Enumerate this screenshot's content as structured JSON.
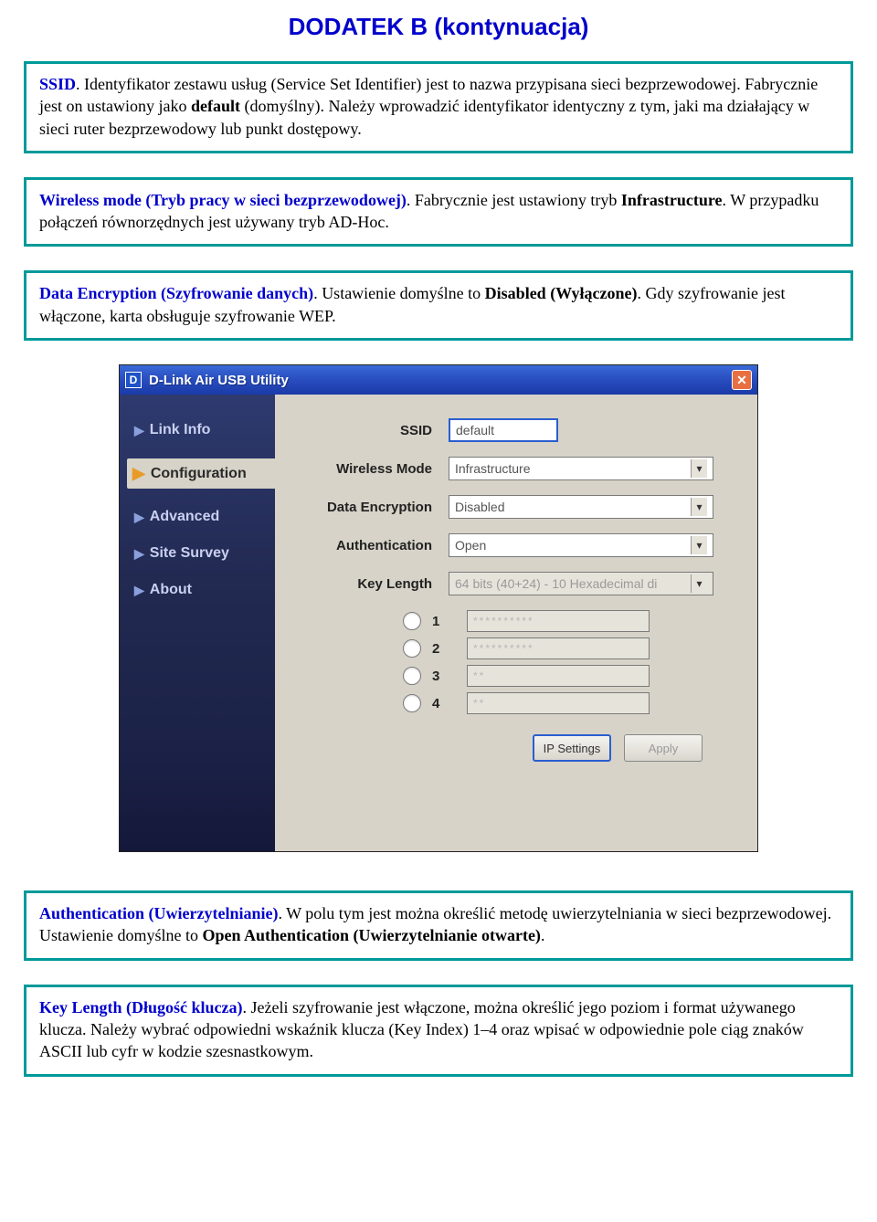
{
  "page": {
    "heading": "DODATEK B (kontynuacja)"
  },
  "callouts": {
    "ssid": {
      "lead": "SSID",
      "text1": ". Identyfikator zestawu usług (Service Set Identifier) jest to nazwa przypisana sieci bezprzewodowej. Fabrycznie jest on ustawiony jako ",
      "bold1": "default",
      "text2": " (domyślny). Należy wprowadzić identyfikator identyczny z tym, jaki ma działający w sieci ruter bezprzewodowy lub punkt dostępowy."
    },
    "wmode": {
      "lead": "Wireless mode (Tryb pracy w sieci bezprzewodowej)",
      "text1": ". Fabrycznie jest ustawiony tryb ",
      "bold1": "Infrastructure",
      "text2": ". W przypadku połączeń równorzędnych jest używany tryb AD-Hoc."
    },
    "dataenc": {
      "lead": "Data Encryption (Szyfrowanie danych)",
      "text1": ". Ustawienie domyślne to ",
      "bold1": "Disabled (Wyłączone)",
      "text2": ". Gdy szyfrowanie jest włączone, karta obsługuje szyfrowanie WEP."
    },
    "auth": {
      "lead": "Authentication (Uwierzytelnianie)",
      "text1": ". W polu tym jest można określić metodę uwierzytelniania w sieci bezprzewodowej. Ustawienie domyślne to ",
      "bold1": "Open Authentication (Uwierzytelnianie otwarte)",
      "text2": "."
    },
    "keylen": {
      "lead": "Key Length (Długość klucza)",
      "text1": ". Jeżeli szyfrowanie jest włączone, można określić jego poziom i format używanego klucza. Należy wybrać odpowiedni wskaźnik klucza (Key Index) 1–4 oraz wpisać w odpowiednie pole ciąg znaków ASCII lub cyfr w kodzie szesnastkowym."
    }
  },
  "window": {
    "title": "D-Link Air USB Utility",
    "dbadge": "D",
    "close": "✕",
    "sidebar": {
      "items": [
        {
          "label": "Link Info",
          "active": false
        },
        {
          "label": "Configuration",
          "active": true
        },
        {
          "label": "Advanced",
          "active": false
        },
        {
          "label": "Site Survey",
          "active": false
        },
        {
          "label": "About",
          "active": false
        }
      ]
    },
    "form": {
      "ssid": {
        "label": "SSID",
        "value": "default"
      },
      "wmode": {
        "label": "Wireless Mode",
        "value": "Infrastructure"
      },
      "dataenc": {
        "label": "Data Encryption",
        "value": "Disabled"
      },
      "auth": {
        "label": "Authentication",
        "value": "Open"
      },
      "keylen": {
        "label": "Key Length",
        "value": "64 bits (40+24) - 10 Hexadecimal di"
      },
      "keys": [
        {
          "num": "1",
          "value": "**********"
        },
        {
          "num": "2",
          "value": "**********"
        },
        {
          "num": "3",
          "value": "**"
        },
        {
          "num": "4",
          "value": "**"
        }
      ],
      "buttons": {
        "ip": "IP Settings",
        "apply": "Apply"
      }
    }
  }
}
